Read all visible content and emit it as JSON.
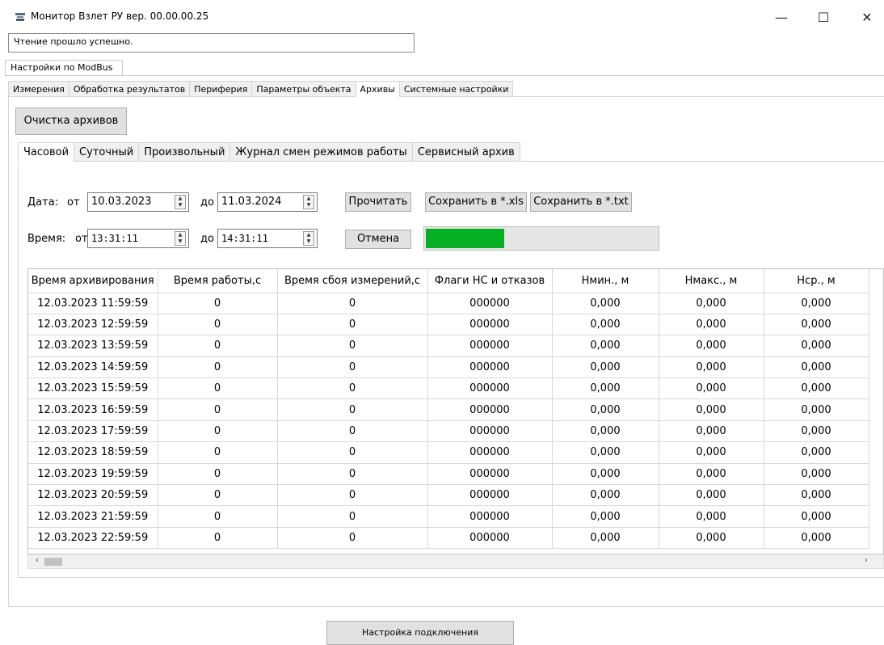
{
  "window": {
    "title": "Монитор Взлет РУ вер. 00.00.00.25",
    "min_glyph": "—",
    "max_glyph": "☐",
    "close_glyph": "✕"
  },
  "status": {
    "text": "Чтение прошло успешно."
  },
  "group_tab": {
    "label": "Настройки по ModBus"
  },
  "main_tabs": [
    {
      "label": "Измерения"
    },
    {
      "label": "Обработка результатов"
    },
    {
      "label": "Периферия"
    },
    {
      "label": "Параметры объекта"
    },
    {
      "label": "Архивы",
      "active": true
    },
    {
      "label": "Системные настройки"
    }
  ],
  "archives": {
    "clear_label": "Очистка архивов",
    "sub_tabs": [
      {
        "label": "Часовой",
        "active": true
      },
      {
        "label": "Суточный"
      },
      {
        "label": "Произвольный"
      },
      {
        "label": "Журнал смен режимов работы"
      },
      {
        "label": "Сервисный архив"
      }
    ],
    "date_label": "Дата:",
    "from_label": "от",
    "to_label": "до",
    "date_from": "10.03.2023",
    "date_to": "11.03.2024",
    "time_label": "Время:",
    "time_from": "13:31:11",
    "time_to": "14:31:11",
    "read_label": "Прочитать",
    "save_xls_label": "Сохранить в *.xls",
    "save_txt_label": "Сохранить в *.txt",
    "cancel_label": "Отмена",
    "progress_fraction": 0.34
  },
  "table": {
    "columns": [
      "Время архивирования",
      "Время работы,с",
      "Время сбоя измерений,с",
      "Флаги НС и отказов",
      "Нмин., м",
      "Нмакс., м",
      "Нср., м"
    ],
    "rows": [
      [
        "12.03.2023 11:59:59",
        "0",
        "0",
        "000000",
        "0,000",
        "0,000",
        "0,000"
      ],
      [
        "12.03.2023 12:59:59",
        "0",
        "0",
        "000000",
        "0,000",
        "0,000",
        "0,000"
      ],
      [
        "12.03.2023 13:59:59",
        "0",
        "0",
        "000000",
        "0,000",
        "0,000",
        "0,000"
      ],
      [
        "12.03.2023 14:59:59",
        "0",
        "0",
        "000000",
        "0,000",
        "0,000",
        "0,000"
      ],
      [
        "12.03.2023 15:59:59",
        "0",
        "0",
        "000000",
        "0,000",
        "0,000",
        "0,000"
      ],
      [
        "12.03.2023 16:59:59",
        "0",
        "0",
        "000000",
        "0,000",
        "0,000",
        "0,000"
      ],
      [
        "12.03.2023 17:59:59",
        "0",
        "0",
        "000000",
        "0,000",
        "0,000",
        "0,000"
      ],
      [
        "12.03.2023 18:59:59",
        "0",
        "0",
        "000000",
        "0,000",
        "0,000",
        "0,000"
      ],
      [
        "12.03.2023 19:59:59",
        "0",
        "0",
        "000000",
        "0,000",
        "0,000",
        "0,000"
      ],
      [
        "12.03.2023 20:59:59",
        "0",
        "0",
        "000000",
        "0,000",
        "0,000",
        "0,000"
      ],
      [
        "12.03.2023 21:59:59",
        "0",
        "0",
        "000000",
        "0,000",
        "0,000",
        "0,000"
      ],
      [
        "12.03.2023 22:59:59",
        "0",
        "0",
        "000000",
        "0,000",
        "0,000",
        "0,000"
      ]
    ]
  },
  "footer": {
    "connect_label": "Настройка подключения"
  },
  "colors": {
    "progress": "#06b025",
    "button_face": "#e1e1e1"
  },
  "icons": {
    "app": "app-icon",
    "spin": "spin-arrows-icon",
    "scroll_up": "scroll-up-icon",
    "scroll_down": "scroll-down-icon",
    "scroll_left": "scroll-left-icon",
    "scroll_right": "scroll-right-icon"
  }
}
